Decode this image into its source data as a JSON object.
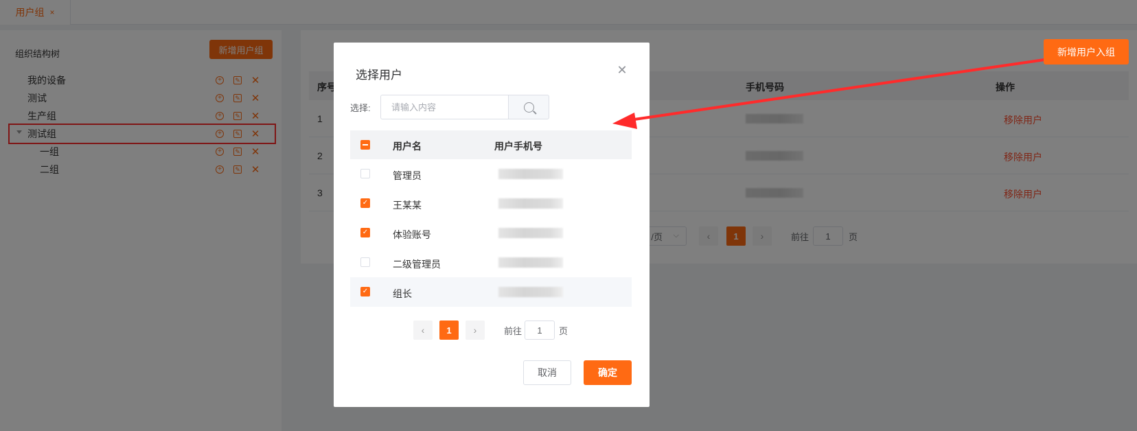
{
  "tabs": [
    {
      "label": "用户组",
      "close": "×"
    }
  ],
  "sidebar": {
    "title": "组织结构树",
    "add_group_label": "新增用户组",
    "tree": [
      {
        "label": "我的设备",
        "level": 0
      },
      {
        "label": "测试",
        "level": 0
      },
      {
        "label": "生产组",
        "level": 0
      },
      {
        "label": "测试组",
        "level": 0,
        "selected": true,
        "expanded": true
      },
      {
        "label": "一组",
        "level": 1
      },
      {
        "label": "二组",
        "level": 1
      }
    ]
  },
  "main": {
    "add_user_label": "新增用户入组",
    "columns": [
      "序号",
      "手机号码",
      "操作"
    ],
    "rows": [
      {
        "index": "1",
        "action": "移除用户"
      },
      {
        "index": "2",
        "action": "移除用户"
      },
      {
        "index": "3",
        "action": "移除用户"
      }
    ],
    "pager": {
      "size_suffix": "/页",
      "current": "1",
      "goto_label": "前往",
      "goto_value": "1",
      "page_suffix": "页"
    }
  },
  "dialog": {
    "title": "选择用户",
    "select_label": "选择:",
    "search_placeholder": "请输入内容",
    "columns": [
      "用户名",
      "用户手机号"
    ],
    "users": [
      {
        "name": "管理员",
        "checked": false
      },
      {
        "name": "王某某",
        "checked": true
      },
      {
        "name": "体验账号",
        "checked": true
      },
      {
        "name": "二级管理员",
        "checked": false
      },
      {
        "name": "组长",
        "checked": true
      }
    ],
    "pager": {
      "current": "1",
      "goto_label": "前往",
      "goto_value": "1",
      "page_suffix": "页"
    },
    "cancel_label": "取消",
    "ok_label": "确定"
  },
  "colors": {
    "accent": "#ff6a13",
    "danger": "#ff4d2d",
    "annotation": "#ff2b2b"
  },
  "icons": {
    "add": "plus-circle-icon",
    "edit": "edit-icon",
    "delete": "close-icon",
    "search": "search-icon"
  }
}
